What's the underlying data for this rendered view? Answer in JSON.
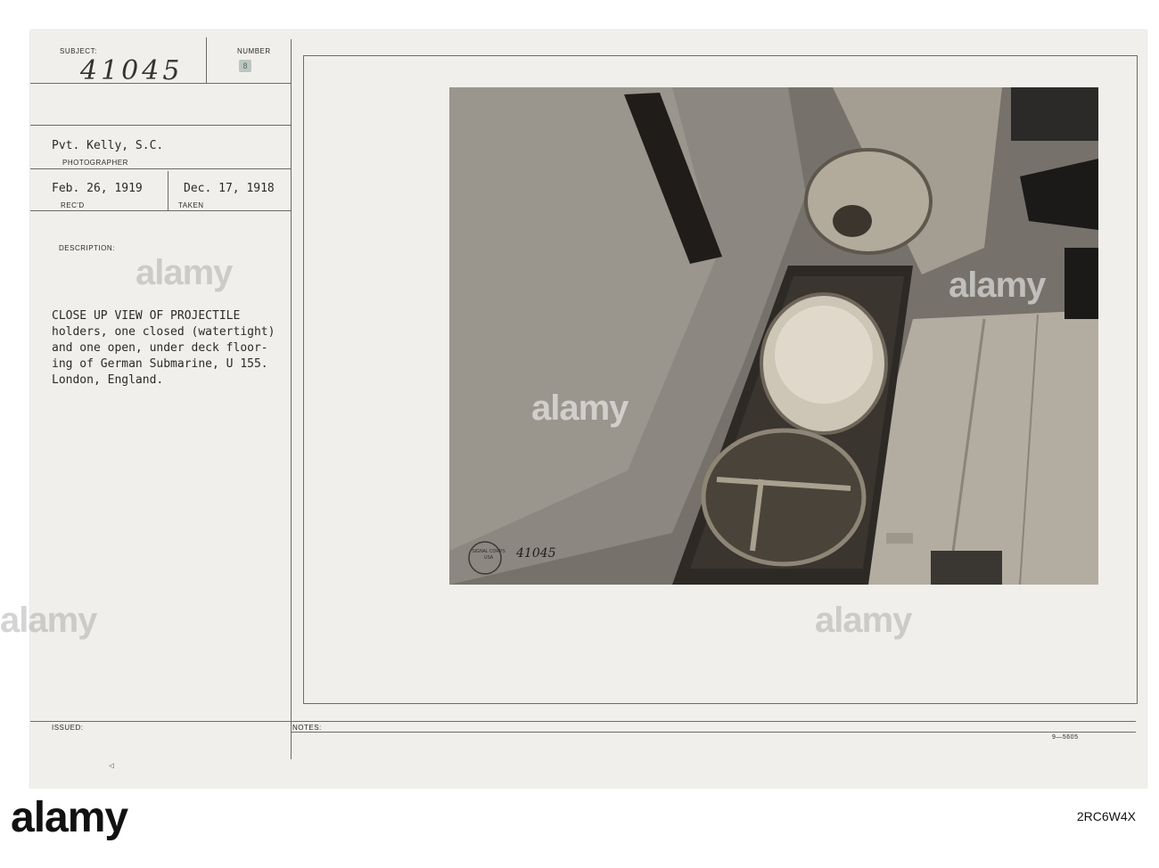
{
  "card": {
    "subject_label": "SUBJECT:",
    "number_label": "NUMBER",
    "subject_number": "41045",
    "number_value": "8",
    "photographer_name": "Pvt. Kelly, S.C.",
    "photographer_label": "PHOTOGRAPHER",
    "received_date": "Feb. 26, 1919",
    "received_label": "REC'D",
    "taken_date": "Dec. 17, 1918",
    "taken_label": "TAKEN",
    "description_label": "DESCRIPTION:",
    "description_lines": [
      "CLOSE UP VIEW OF PROJECTILE",
      "holders, one closed (watertight)",
      "and one open, under deck floor-",
      "ing of German Submarine, U 155.",
      "London, England."
    ],
    "issued_label": "ISSUED:",
    "notes_label": "NOTES:",
    "form_code": "9—5605"
  },
  "photo": {
    "stamp_text": "SIGNAL CORPS USA",
    "photo_number": "41045"
  },
  "watermark": {
    "text": "alamy"
  },
  "footer": {
    "brand": "alamy",
    "image_id": "2RC6W4X"
  }
}
